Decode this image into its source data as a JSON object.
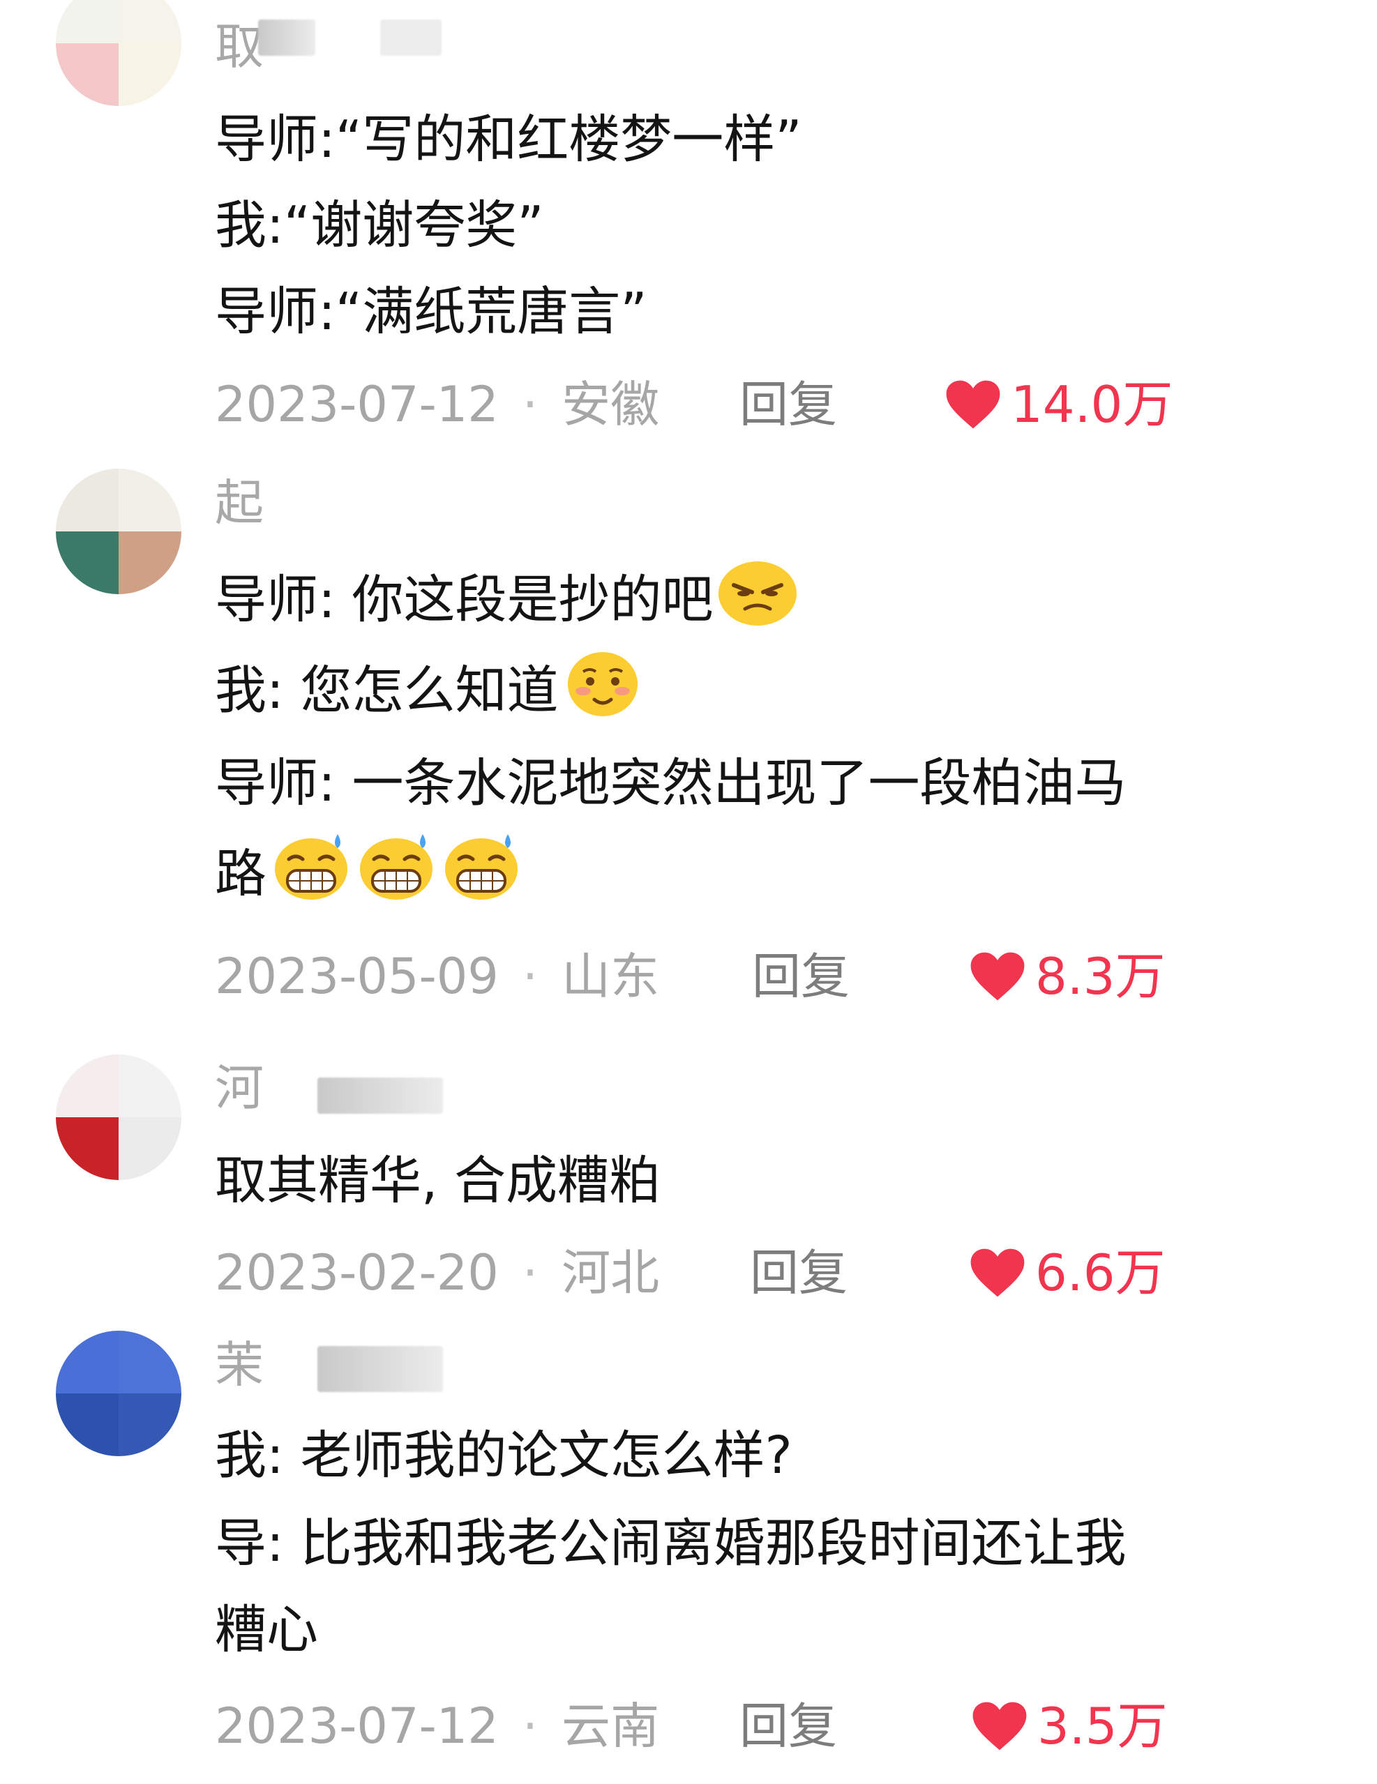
{
  "comments": [
    {
      "username": "取",
      "lines": [
        "导师:“写的和红楼梦一样”",
        "我:“谢谢夸奖”",
        "导师:“满纸荒唐言”"
      ],
      "date": "2023-07-12",
      "location": "安徽",
      "reply": "回复",
      "likes": "14.0万"
    },
    {
      "username": "起",
      "lines": [
        "导师: 你这段是抄的吧",
        "我: 您怎么知道",
        "导师: 一条水泥地突然出现了一段柏油马",
        "路"
      ],
      "date": "2023-05-09",
      "location": "山东",
      "reply": "回复",
      "likes": "8.3万"
    },
    {
      "username": "河",
      "lines": [
        "取其精华, 合成糟粕"
      ],
      "date": "2023-02-20",
      "location": "河北",
      "reply": "回复",
      "likes": "6.6万"
    },
    {
      "username": "茉",
      "lines": [
        "我: 老师我的论文怎么样?",
        "导: 比我和我老公闹离婚那段时间还让我",
        "糟心"
      ],
      "date": "2023-07-12",
      "location": "云南",
      "reply": "回复",
      "likes": "3.5万"
    }
  ],
  "icons": {
    "like": "heart-icon",
    "emojis": [
      "smirk-emoji",
      "shy-smile-emoji",
      "sweat-grin-emoji"
    ]
  },
  "colors": {
    "accent": "#f2354f",
    "meta": "#a6a6a6",
    "text": "#141414"
  }
}
